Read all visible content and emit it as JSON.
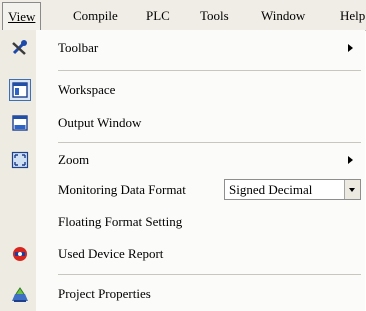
{
  "menubar": {
    "items": [
      {
        "label": "View",
        "active": true
      },
      {
        "label": "Compile"
      },
      {
        "label": "PLC"
      },
      {
        "label": "Tools"
      },
      {
        "label": "Window"
      },
      {
        "label": "Help"
      }
    ]
  },
  "menu": {
    "items": [
      {
        "label": "Toolbar",
        "icon": "tools-icon",
        "submenu": true
      },
      {
        "label": "Workspace",
        "icon": "workspace-icon",
        "checked": true
      },
      {
        "label": "Output Window",
        "icon": "output-window-icon"
      },
      {
        "label": "Zoom",
        "icon": "zoom-icon",
        "submenu": true
      },
      {
        "label": "Monitoring Data Format",
        "combo_value": "Signed Decimal"
      },
      {
        "label": "Floating Format Setting"
      },
      {
        "label": "Used Device Report",
        "icon": "device-report-icon"
      },
      {
        "label": "Project Properties",
        "icon": "project-properties-icon"
      }
    ]
  }
}
